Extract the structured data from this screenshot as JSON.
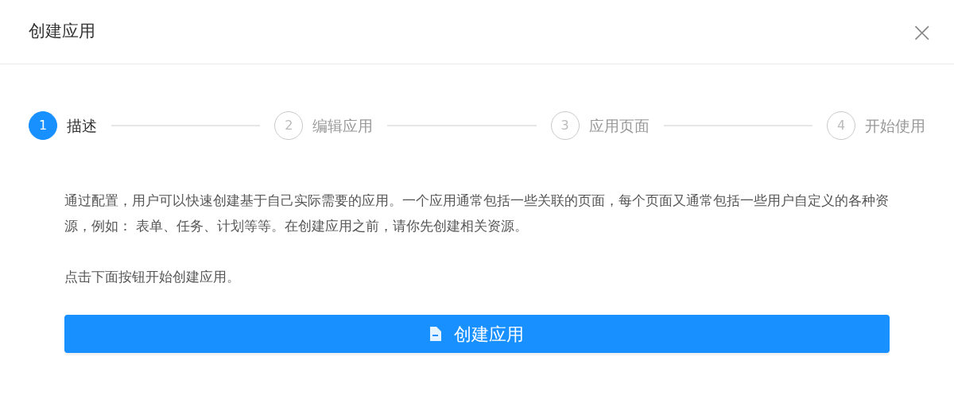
{
  "dialog": {
    "title": "创建应用",
    "close": "×"
  },
  "steps": [
    {
      "number": "1",
      "label": "描述",
      "selected": true
    },
    {
      "number": "2",
      "label": "编辑应用",
      "selected": false
    },
    {
      "number": "3",
      "label": "应用页面",
      "selected": false
    },
    {
      "number": "4",
      "label": "开始使用",
      "selected": false
    }
  ],
  "paragraphs": [
    "通过配置，用户可以快速创建基于自己实际需要的应用。一个应用通常包括一些关联的页面，每个页面又通常包括一些用户自定义的各种资源，例如： 表单、任务、计划等等。在创建应用之前，请你先创建相关资源。",
    "点击下面按钮开始创建应用。"
  ],
  "button": {
    "label": "创建应用"
  }
}
